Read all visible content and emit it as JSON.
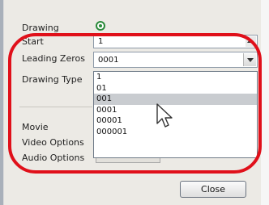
{
  "dialog": {
    "drawing_label": "Drawing",
    "start_label": "Start",
    "start_value": "1",
    "leading_zeros_label": "Leading Zeros",
    "leading_zeros_value": "0001",
    "drawing_type_label": "Drawing Type",
    "movie_label": "Movie",
    "video_options_label": "Video Options",
    "audio_options_label": "Audio Options",
    "close_label": "Close"
  },
  "dropdown": {
    "options": [
      "1",
      "01",
      "001",
      "0001",
      "00001",
      "000001"
    ],
    "selected": "001"
  },
  "icons": {
    "drawing_radio": "radio-selected-icon",
    "cursor": "mouse-pointer-icon",
    "dropdown_arrow": "chevron-down-icon",
    "spin_up": "spin-up-icon"
  },
  "colors": {
    "highlight": "#e0101a",
    "radio": "#2a8a3a",
    "selection": "#c9ccd0"
  }
}
